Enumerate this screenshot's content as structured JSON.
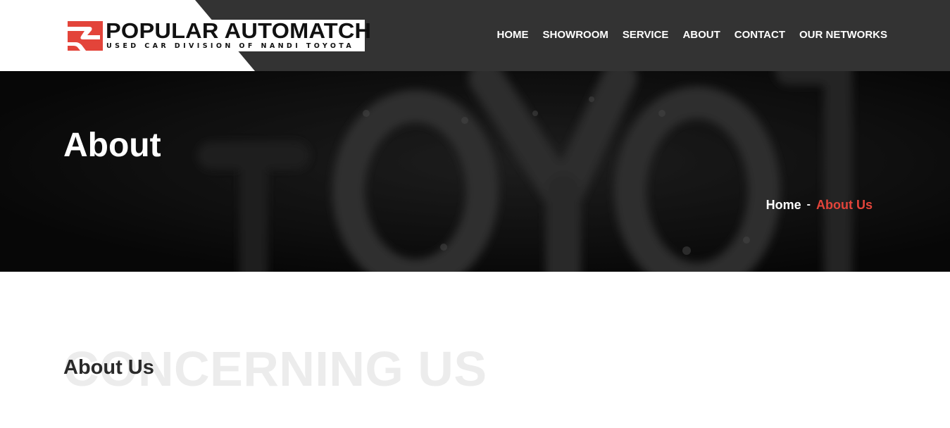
{
  "brand": {
    "name": "POPULAR AUTOMATCH",
    "tagline": "USED CAR DIVISION OF NANDI TOYOTA",
    "logo_icon": "red-road-mark-icon",
    "accent_color": "#e3443a"
  },
  "nav": {
    "items": [
      {
        "label": "HOME"
      },
      {
        "label": "SHOWROOM"
      },
      {
        "label": "SERVICE"
      },
      {
        "label": "ABOUT"
      },
      {
        "label": "CONTACT"
      },
      {
        "label": "OUR NETWORKS"
      }
    ]
  },
  "hero": {
    "title": "About",
    "breadcrumb": {
      "home": "Home",
      "separator": "-",
      "current": "About Us"
    }
  },
  "section": {
    "background_text": "CONCERNING US",
    "heading": "About Us"
  }
}
